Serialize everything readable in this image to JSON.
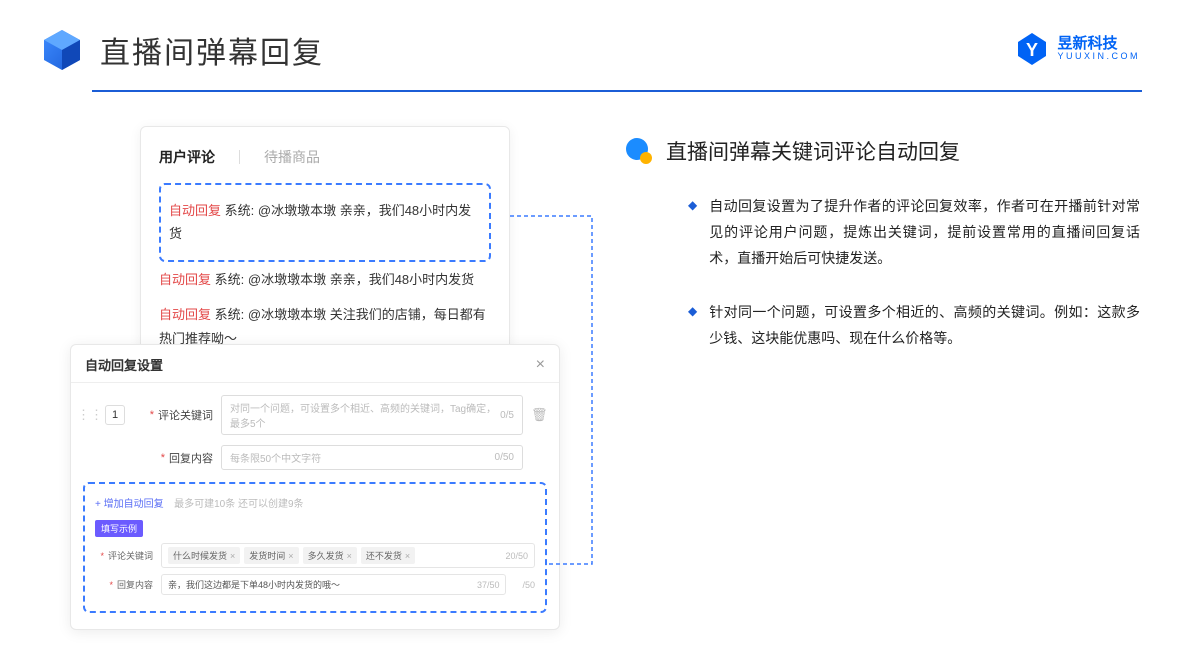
{
  "header": {
    "title": "直播间弹幕回复",
    "brand_cn": "昱新科技",
    "brand_en": "YUUXIN.COM"
  },
  "comments": {
    "tabs": {
      "active": "用户评论",
      "inactive": "待播商品"
    },
    "items": [
      {
        "tag": "自动回复",
        "sys": "系统:",
        "text": "@冰墩墩本墩 亲亲，我们48小时内发货"
      },
      {
        "tag": "自动回复",
        "sys": "系统:",
        "text": "@冰墩墩本墩 亲亲，我们48小时内发货"
      },
      {
        "tag": "自动回复",
        "sys": "系统:",
        "text": "@冰墩墩本墩 关注我们的店铺，每日都有热门推荐呦～"
      }
    ]
  },
  "settings": {
    "title": "自动回复设置",
    "index": "1",
    "row1": {
      "label": "评论关键词",
      "placeholder": "对同一个问题，可设置多个相近、高频的关键词，Tag确定，最多5个",
      "count": "0/5"
    },
    "row2": {
      "label": "回复内容",
      "placeholder": "每条限50个中文字符",
      "count": "0/50"
    },
    "add": {
      "link": "+ 增加自动回复",
      "hint": "最多可建10条 还可以创建9条"
    },
    "example_badge": "填写示例",
    "ex_row1": {
      "label": "评论关键词",
      "tags": [
        "什么时候发货",
        "发货时间",
        "多久发货",
        "还不发货"
      ],
      "count": "20/50"
    },
    "ex_row2": {
      "label": "回复内容",
      "text": "亲，我们这边都是下单48小时内发货的哦～",
      "count": "37/50"
    },
    "tail_count": "/50"
  },
  "right": {
    "title": "直播间弹幕关键词评论自动回复",
    "bullets": [
      "自动回复设置为了提升作者的评论回复效率，作者可在开播前针对常见的评论用户问题，提炼出关键词，提前设置常用的直播间回复话术，直播开始后可快捷发送。",
      "针对同一个问题，可设置多个相近的、高频的关键词。例如：这款多少钱、这块能优惠吗、现在什么价格等。"
    ]
  }
}
